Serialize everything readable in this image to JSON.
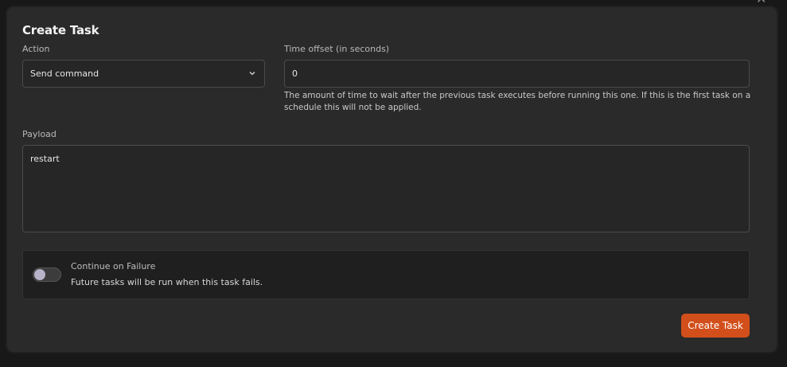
{
  "dialog": {
    "title": "Create Task",
    "close_icon": "close-icon"
  },
  "action": {
    "label": "Action",
    "selected": "Send command",
    "chevron_icon": "chevron-down-icon"
  },
  "time_offset": {
    "label": "Time offset (in seconds)",
    "value": "0",
    "help_text": "The amount of time to wait after the previous task executes before running this one. If this is the first task on a schedule this will not be applied."
  },
  "payload": {
    "label": "Payload",
    "value": "restart"
  },
  "continue_on_failure": {
    "title": "Continue on Failure",
    "description": "Future tasks will be run when this task fails.",
    "enabled": false
  },
  "footer": {
    "create_button": "Create Task"
  },
  "colors": {
    "accent": "#d24f1b",
    "modal_bg": "#2a2a2a",
    "panel_bg": "#1f1f1f"
  }
}
